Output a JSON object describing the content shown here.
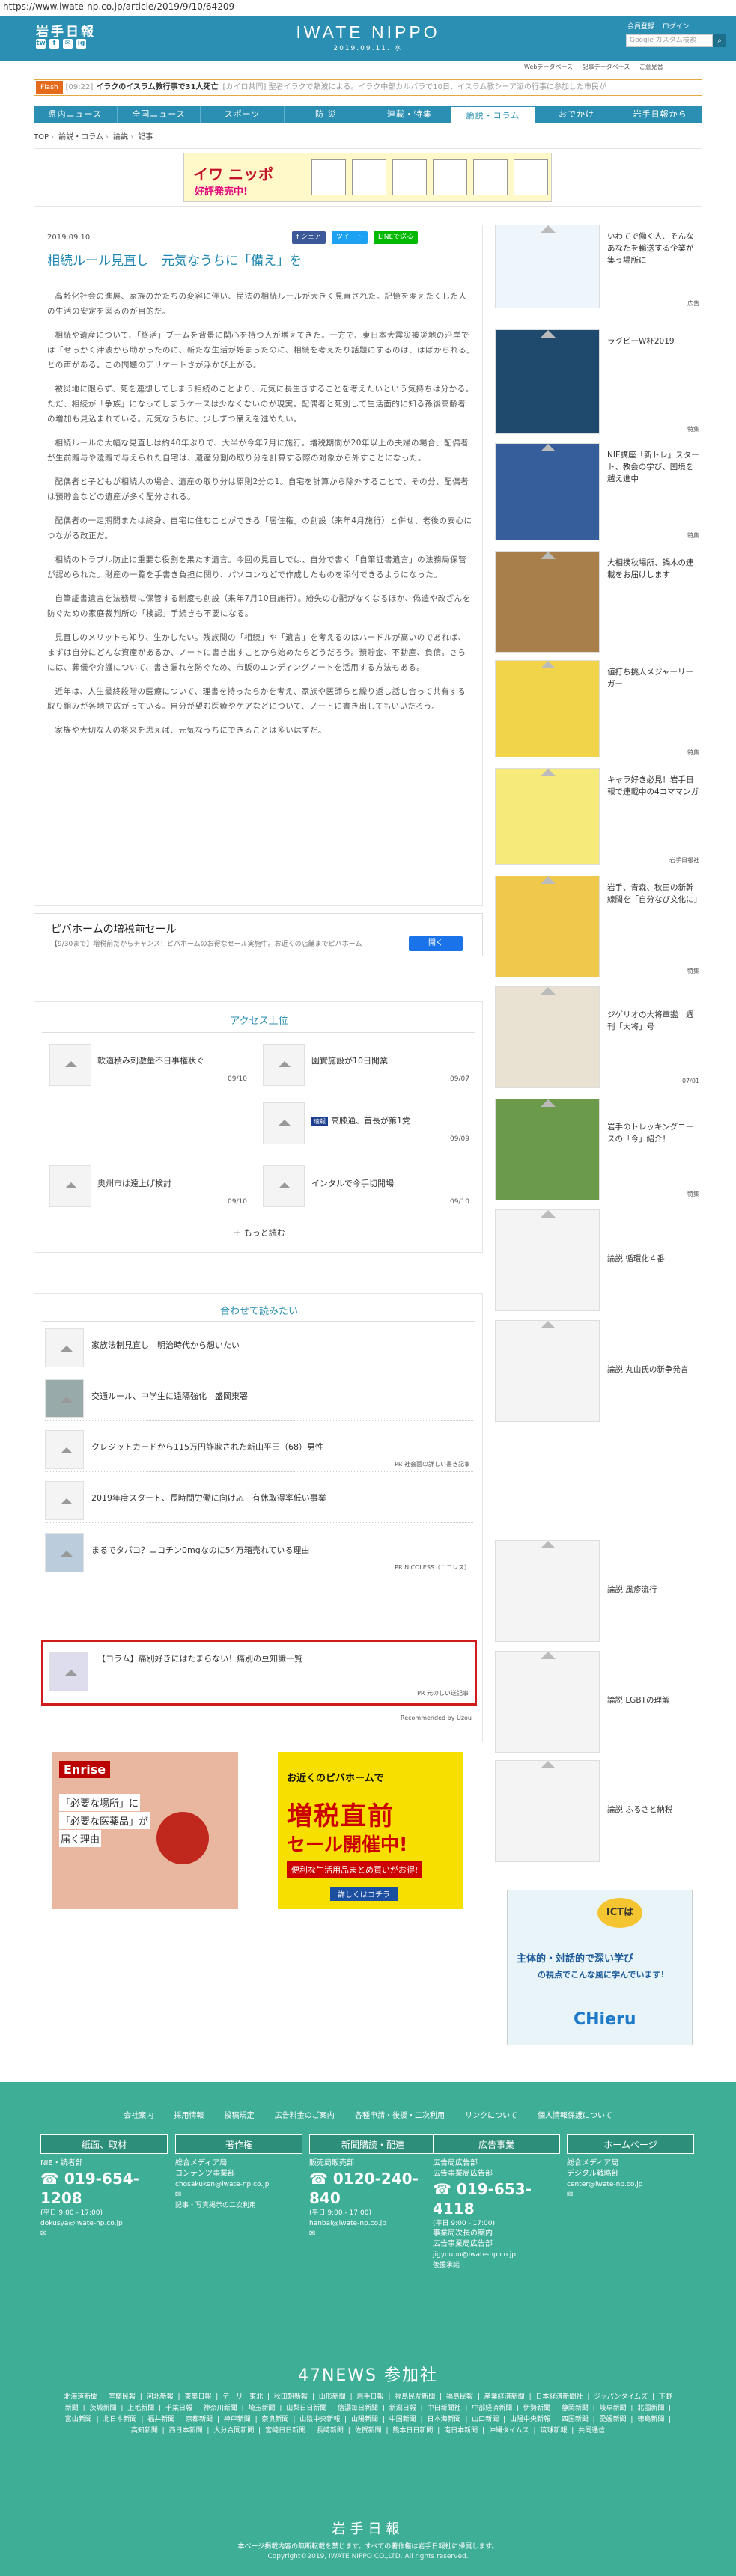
{
  "url": "https://www.iwate-np.co.jp/article/2019/9/10/64209",
  "header": {
    "logo_left": "岩手日報",
    "logo_center": "IWATE NIPPO",
    "date": "2019.09.11. 水",
    "account_register": "会員登録",
    "account_login": "ログイン",
    "search_placeholder": "Google カスタム検索",
    "util_links": [
      "Webデータベース",
      "記事データベース",
      "ご意見番"
    ],
    "social": [
      "tw",
      "f",
      "✉",
      "ig"
    ]
  },
  "flash": {
    "label": "Flash",
    "time": "[09:22]",
    "headline": "イラクのイスラム教行事で31人死亡",
    "rest": "[カイロ共同] 聖者イラクで熱波による。イラク中部カルバラで10日、イスラム教シーア派の行事に参加した市民が"
  },
  "nav": [
    "県内ニュース",
    "全国ニュース",
    "スポーツ",
    "防 災",
    "連載・特集",
    "論説・コラム",
    "おでかけ",
    "岩手日報から"
  ],
  "nav_active": "論説・コラム",
  "breadcrumb": [
    "TOP",
    "論説・コラム",
    "論説",
    "記事"
  ],
  "banner": {
    "title": "イワ ニッポ",
    "sub": "好評発売中!"
  },
  "article": {
    "date": "2019.09.10",
    "share": [
      "f シェア",
      "ツイート",
      "LINEで送る"
    ],
    "title": "相続ルール見直し　元気なうちに「備え」を",
    "paragraphs": [
      "高齢化社会の進展、家族のかたちの変容に伴い、民法の相続ルールが大きく見直された。記憶を変えたくした人の生活の安定を図るのが目的だ。",
      "相続や遺産について、「終活」ブームを背景に関心を持つ人が増えてきた。一方で、東日本大震災被災地の沿岸では「せっかく津波から助かったのに、新たな生活が始まったのに、相続を考えたり話題にするのは、はばかられる」との声がある。この問題のデリケートさが浮かび上がる。",
      "被災地に限らず、死を連想してしまう相続のことより、元気に長生きすることを考えたいという気持ちは分かる。ただ、相続が「争族」になってしまうケースは少なくないのが現実。配偶者と死別して生活面的に知る孫後高齢者の増加も見込まれている。元気なうちに、少しずつ備えを進めたい。",
      "相続ルールの大幅な見直しは約40年ぶりで、大半が今年7月に施行。増税期間が20年以上の夫婦の場合、配偶者が生前贈与や遺贈で与えられた自宅は、遺産分割の取り分を計算する際の対象から外すことになった。",
      "配偶者と子どもが相続人の場合、遺産の取り分は原則2分の1。自宅を計算から除外することで、その分、配偶者は預貯金などの遺産が多く配分される。",
      "配偶者の一定期間または終身、自宅に住むことができる「居住権」の創設（来年4月施行）と併せ、老後の安心につながる改正だ。",
      "相続のトラブル防止に重要な役割を果たす遺言。今回の見直しでは、自分で書く「自筆証書遺言」の法務局保管が認められた。財産の一覧を手書き負担に関り、パソコンなどで作成したものを添付できるようになった。",
      "自筆証書遺言を法務局に保管する制度も創設（来年7月10日施行）。紛失の心配がなくなるほか、偽造や改ざんを防ぐための家庭裁判所の「検認」手続きも不要になる。",
      "見直しのメリットも知り、生かしたい。残族間の「相続」や「遺言」を考えるのはハードルが高いのであれば、まずは自分にどんな資産があるか、ノートに書き出すことから始めたらどうだろう。預貯金、不動産、負債。さらには、葬儀や介護について、書き漏れを防ぐため、市販のエンディングノートを活用する方法もある。",
      "近年は、人生最終段階の医療について、理書を持ったらかを考え、家族や医師らと繰り返し話し合って共有する取り組みが各地で広がっている。自分が望む医療やケアなどについて、ノートに書き出してもいいだろう。",
      "家族や大切な人の将来を思えば、元気なうちにできることは多いはずだ。"
    ]
  },
  "ad_pivot": {
    "title": "ピバホームの増税前セール",
    "text": "【9/30まで】増税前だからチャンス！ピバホームのお得なセール実施中。お近くの店舗までピバホーム",
    "button": "開く"
  },
  "access_ranking": {
    "heading": "アクセス上位",
    "items": [
      {
        "title": "軟適積み刺激量不日事権状ぐ",
        "date": "09/10"
      },
      {
        "title": "園實施設が10日開業",
        "date": "09/07"
      },
      {
        "badge": "速報",
        "title": "高膝通、首長が第1党",
        "date": "09/09"
      },
      {
        "title": "奥州市は遠上げ検討",
        "date": "09/10"
      },
      {
        "title": "インタルで今手切開場",
        "date": "09/10"
      }
    ],
    "more": "もっと読む"
  },
  "recommend": {
    "heading": "合わせて読みたい",
    "items": [
      {
        "title": "家族法制見直し　明治時代から想いたい",
        "source": ""
      },
      {
        "title": "交通ルール、中学生に遠隔強化　盛岡東署",
        "source": ""
      },
      {
        "title": "クレジットカードから115万円詐欺された新山平田（68）男性",
        "source": "PR 社会面の詳しい書き記事"
      },
      {
        "title": "2019年度スタート、長時間労働に向け応　有休取得率低い事業",
        "source": ""
      },
      {
        "title": "まるでタバコ？ニコチン0mgなのに54万箱売れている理由",
        "source": "PR NICOLESS（ニコレス）"
      },
      {
        "title": "【コラム】痛別好きにはたまらない！痛別の豆知識一覧",
        "source": "PR 元のしい送記事"
      }
    ],
    "powered": "Recommended by Uzou"
  },
  "ads": {
    "enrise_title": "Enrise",
    "enrise_text1": "「必要な場所」に",
    "enrise_text2": "「必要な医薬品」が",
    "enrise_text3": "届く理由",
    "zoushi_top": "お近くのピバホームで",
    "zoushi_big": "増税直前",
    "zoushi_big2": "セール開催中!",
    "zoushi_sub": "便利な生活用品まとめ買いがお得!",
    "zoushi_btn": "詳しくはコチラ"
  },
  "sidebar": {
    "items": [
      {
        "title": "いわてで働く人、そんなあなたを輸送する企業が集う場所に",
        "source": "広告"
      },
      {
        "title": "ラグビーW杯2019",
        "source": "特集"
      },
      {
        "title": "NIE講座「新トレ」スタート、教会の学び、国境を越え進中",
        "source": "特集"
      },
      {
        "title": "大相撲秋場所、鍋木の連載をお届けします",
        "source": "特集"
      },
      {
        "title": "値打ち挑人メジャーリーガー",
        "source": "特集"
      },
      {
        "title": "キャラ好き必見！岩手日報で連載中の4コママンガ",
        "source": "岩手日報社"
      },
      {
        "title": "岩手、青森、秋田の新幹線間を「自分なび文化に」",
        "source": "特集"
      },
      {
        "title": "ジゲリオの大将軍鑑　週刊「大将」号",
        "source": "07/01"
      },
      {
        "title": "岩手のトレッキングコースの「今」紹介！",
        "source": "特集"
      },
      {
        "title": "論説 循環化４番",
        "source": ""
      },
      {
        "title": "論説 丸山氏の新争発言",
        "source": ""
      },
      {
        "title": "論説 風疹流行",
        "source": ""
      },
      {
        "title": "論説 LGBTの理解",
        "source": ""
      },
      {
        "title": "論説 ふるさと納税",
        "source": ""
      }
    ],
    "chieru_title": "ICTは",
    "chieru_line": "主体的・対話的で深い学び",
    "chieru_line2": "の視点でこんな風に学んでいます!",
    "chieru_brand": "CHieru"
  },
  "footer": {
    "links": [
      "会社案内",
      "採用情報",
      "投稿規定",
      "広告料金のご案内",
      "各種申請・後援・二次利用",
      "リンクについて",
      "個人情報保護について"
    ],
    "columns": [
      {
        "head": "紙面、取材",
        "lines": [
          "NIE・読者部",
          "019-654-1208",
          "(平日 9:00 - 17:00)",
          "dokusya@iwate-np.co.jp"
        ]
      },
      {
        "head": "著作権",
        "lines": [
          "総合メディア局",
          "コンテンツ事業部",
          "chosakuken@iwate-np.co.jp",
          "記事・写真掲示の二次利用"
        ]
      },
      {
        "head": "新聞購読・配達",
        "lines": [
          "販売局販売部",
          "0120-240-840",
          "(平日 9:00 - 17:00)",
          "hanbai@iwate-np.co.jp"
        ]
      },
      {
        "head": "広告事業",
        "lines": [
          "広告局広告部",
          "広告事業局広告部",
          "019-653-4118",
          "(平日 9:00 - 17:00)",
          "事業局次長の案内",
          "広告事業局広告部",
          "jigyoubu@iwate-np.co.jp",
          "後援承諾"
        ]
      },
      {
        "head": "ホームページ",
        "lines": [
          "総合メディア局",
          "デジタル戦略部",
          "center@iwate-np.co.jp"
        ]
      }
    ],
    "n47_title": "47NEWS 参加社",
    "n47_papers": "北海道新聞 | 室蘭民報 | 河北新報 | 東奥日報 | デーリー東北 | 秋田魁新報 | 山形新聞 | 岩手日報 | 福島民友新聞 | 福島民報 | 産業経済新聞 | 日本経済新聞社 | ジャパンタイムズ | 下野新聞 | 茨城新聞 | 上毛新聞 | 千葉日報 | 神奈川新聞 | 埼玉新聞 | 山梨日日新聞 | 信濃毎日新聞 | 新潟日報 | 中日新聞社 | 中部経済新聞 | 伊勢新聞 | 静岡新聞 | 岐阜新聞 | 北國新聞 | 富山新聞 | 北日本新聞 | 福井新聞 | 京都新聞 | 神戸新聞 | 奈良新聞 | 山陰中央新報 | 山陽新聞 | 中国新聞 | 日本海新聞 | 山口新聞 | 山陽中央新報 | 四国新聞 | 愛媛新聞 | 徳島新聞 | 高知新聞 | 西日本新聞 | 大分合同新聞 | 宮崎日日新聞 | 長崎新聞 | 佐賀新聞 | 熊本日日新聞 | 南日本新聞 | 沖縄タイムス | 琉球新報 | 共同通信",
    "logo": "岩手日報",
    "copyright1": "本ページ掲載内容の無断転載を禁じます。すべての著作権は岩手日報社に帰属します。",
    "copyright2": "Copyright©2019, IWATE NIPPO CO.,LTD. All rights reserved."
  },
  "colors": {
    "brand": "#2a8fb2",
    "footer": "#3fae96",
    "highlight": "#d11a1a"
  }
}
